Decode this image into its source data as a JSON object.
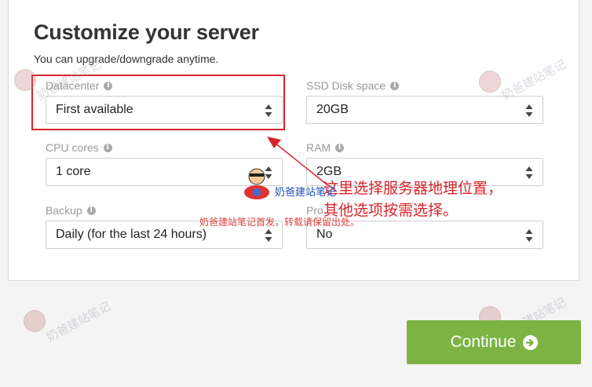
{
  "header": {
    "title": "Customize your server",
    "subtitle": "You can upgrade/downgrade anytime."
  },
  "fields": {
    "datacenter": {
      "label": "Datacenter",
      "value": "First available"
    },
    "ssd": {
      "label": "SSD Disk space",
      "value": "20GB"
    },
    "cpu": {
      "label": "CPU cores",
      "value": "1 core"
    },
    "ram": {
      "label": "RAM",
      "value": "2GB"
    },
    "backup": {
      "label": "Backup",
      "value": "Daily (for the last 24 hours)"
    },
    "pro": {
      "label": "Pro",
      "value": "No"
    }
  },
  "annotation": {
    "line1": "这里选择服务器地理位置，",
    "line2": "其他选项按需选择。",
    "repost_note": "奶爸建站笔记首发，转载请保留出处。"
  },
  "watermark": {
    "text": "奶爸建站笔记"
  },
  "actions": {
    "continue_label": "Continue"
  },
  "colors": {
    "accent_green": "#7cb342",
    "annotation_red": "#d9232a"
  }
}
